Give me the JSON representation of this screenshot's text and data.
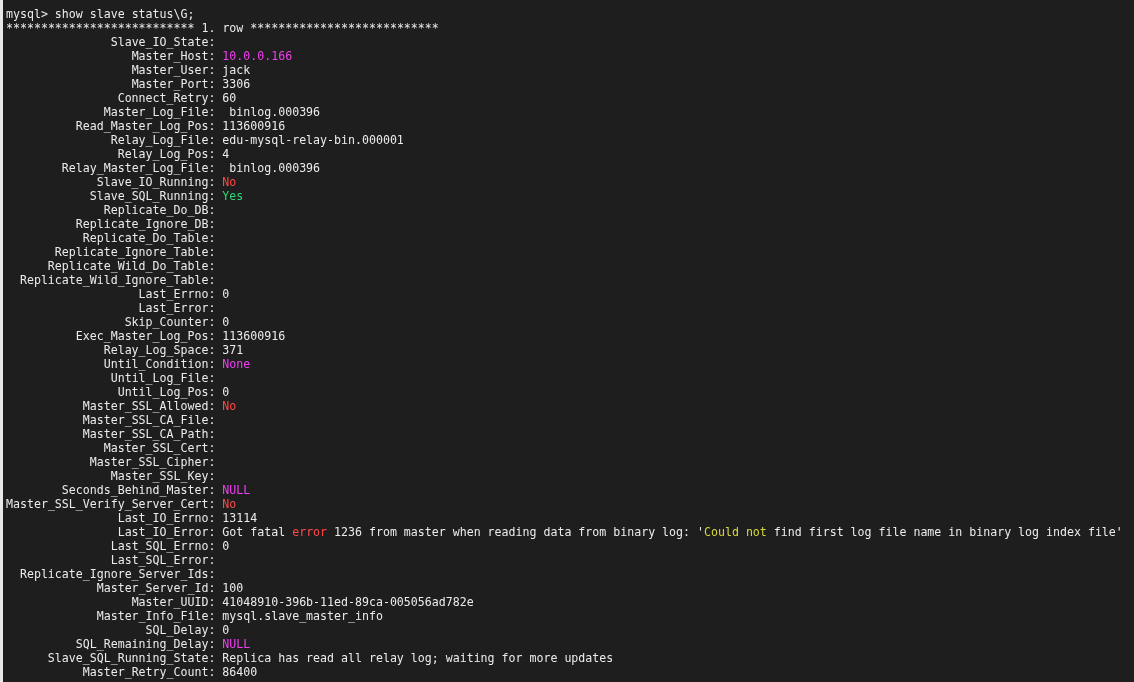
{
  "terminal": {
    "command_line": "mysql> show slave status\\G;",
    "row_header": "*************************** 1. row ***************************",
    "fields": [
      {
        "label": "Slave_IO_State:"
      },
      {
        "label": "Master_Host:",
        "value": [
          {
            "text": "10.0.0.166",
            "color": "#f040f0"
          }
        ]
      },
      {
        "label": "Master_User:",
        "value": [
          {
            "text": "jack"
          }
        ]
      },
      {
        "label": "Master_Port:",
        "value": [
          {
            "text": "3306"
          }
        ]
      },
      {
        "label": "Connect_Retry:",
        "value": [
          {
            "text": "60"
          }
        ]
      },
      {
        "label": "Master_Log_File:",
        "value": [
          {
            "text": " binlog.000396"
          }
        ]
      },
      {
        "label": "Read_Master_Log_Pos:",
        "value": [
          {
            "text": "113600916"
          }
        ]
      },
      {
        "label": "Relay_Log_File:",
        "value": [
          {
            "text": "edu-mysql-relay-bin.000001"
          }
        ]
      },
      {
        "label": "Relay_Log_Pos:",
        "value": [
          {
            "text": "4"
          }
        ]
      },
      {
        "label": "Relay_Master_Log_File:",
        "value": [
          {
            "text": " binlog.000396"
          }
        ]
      },
      {
        "label": "Slave_IO_Running:",
        "value": [
          {
            "text": "No",
            "color": "#ff4a4a"
          }
        ]
      },
      {
        "label": "Slave_SQL_Running:",
        "value": [
          {
            "text": "Yes",
            "color": "#2ed573"
          }
        ]
      },
      {
        "label": "Replicate_Do_DB:"
      },
      {
        "label": "Replicate_Ignore_DB:"
      },
      {
        "label": "Replicate_Do_Table:"
      },
      {
        "label": "Replicate_Ignore_Table:"
      },
      {
        "label": "Replicate_Wild_Do_Table:"
      },
      {
        "label": "Replicate_Wild_Ignore_Table:"
      },
      {
        "label": "Last_Errno:",
        "value": [
          {
            "text": "0"
          }
        ]
      },
      {
        "label": "Last_Error:"
      },
      {
        "label": "Skip_Counter:",
        "value": [
          {
            "text": "0"
          }
        ]
      },
      {
        "label": "Exec_Master_Log_Pos:",
        "value": [
          {
            "text": "113600916"
          }
        ]
      },
      {
        "label": "Relay_Log_Space:",
        "value": [
          {
            "text": "371"
          }
        ]
      },
      {
        "label": "Until_Condition:",
        "value": [
          {
            "text": "None",
            "color": "#f040f0"
          }
        ]
      },
      {
        "label": "Until_Log_File:"
      },
      {
        "label": "Until_Log_Pos:",
        "value": [
          {
            "text": "0"
          }
        ]
      },
      {
        "label": "Master_SSL_Allowed:",
        "value": [
          {
            "text": "No",
            "color": "#ff4a4a"
          }
        ]
      },
      {
        "label": "Master_SSL_CA_File:"
      },
      {
        "label": "Master_SSL_CA_Path:"
      },
      {
        "label": "Master_SSL_Cert:"
      },
      {
        "label": "Master_SSL_Cipher:"
      },
      {
        "label": "Master_SSL_Key:"
      },
      {
        "label": "Seconds_Behind_Master:",
        "value": [
          {
            "text": "NULL",
            "color": "#f040f0"
          }
        ]
      },
      {
        "label": "Master_SSL_Verify_Server_Cert:",
        "value": [
          {
            "text": "No",
            "color": "#ff4a4a"
          }
        ]
      },
      {
        "label": "Last_IO_Errno:",
        "value": [
          {
            "text": "13114"
          }
        ]
      },
      {
        "label": "Last_IO_Error:",
        "value": [
          {
            "text": "Got fatal "
          },
          {
            "text": "error",
            "color": "#ff4a4a"
          },
          {
            "text": " 1236 from master when reading data from binary log: '"
          },
          {
            "text": "Could not",
            "color": "#d8d83a"
          },
          {
            "text": " find first log file name in binary log index file'"
          }
        ]
      },
      {
        "label": "Last_SQL_Errno:",
        "value": [
          {
            "text": "0"
          }
        ]
      },
      {
        "label": "Last_SQL_Error:"
      },
      {
        "label": "Replicate_Ignore_Server_Ids:"
      },
      {
        "label": "Master_Server_Id:",
        "value": [
          {
            "text": "100"
          }
        ]
      },
      {
        "label": "Master_UUID:",
        "value": [
          {
            "text": "41048910-396b-11ed-89ca-005056ad782e"
          }
        ]
      },
      {
        "label": "Master_Info_File:",
        "value": [
          {
            "text": "mysql.slave_master_info"
          }
        ]
      },
      {
        "label": "SQL_Delay:",
        "value": [
          {
            "text": "0"
          }
        ]
      },
      {
        "label": "SQL_Remaining_Delay:",
        "value": [
          {
            "text": "NULL",
            "color": "#f040f0"
          }
        ]
      },
      {
        "label": "Slave_SQL_Running_State:",
        "value": [
          {
            "text": "Replica has read all relay log; waiting for more updates"
          }
        ]
      },
      {
        "label": "Master_Retry_Count:",
        "value": [
          {
            "text": "86400"
          }
        ]
      }
    ]
  }
}
